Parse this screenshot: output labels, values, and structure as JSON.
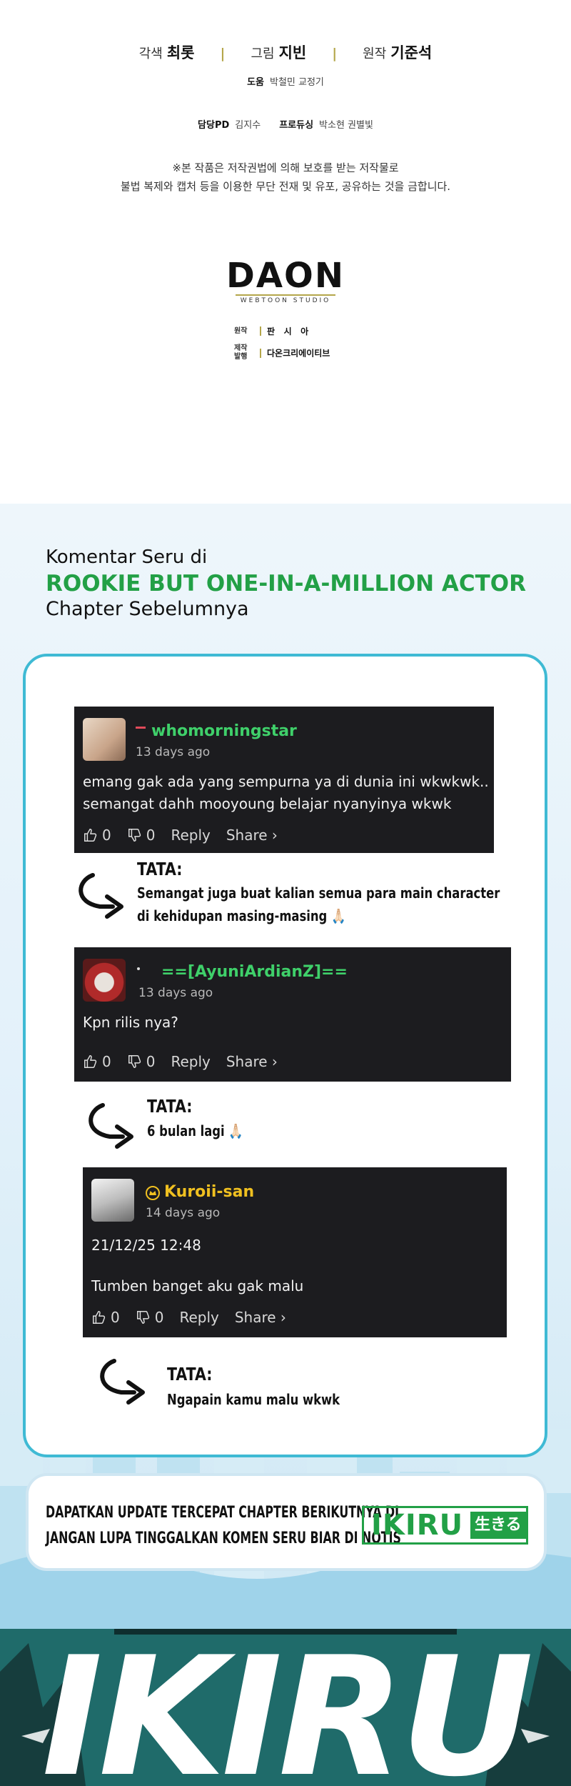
{
  "credits": {
    "roles": [
      {
        "label": "각색",
        "name": "최롯"
      },
      {
        "label": "그림",
        "name": "지빈"
      },
      {
        "label": "원작",
        "name": "기준석"
      }
    ],
    "assist": {
      "label": "도움",
      "names": "박철민 교정기"
    },
    "pd": {
      "label": "담당PD",
      "name": "김지수"
    },
    "producing": {
      "label": "프로듀싱",
      "names": "박소현 권별빛"
    },
    "notice_line1": "※본 작품은 저작권법에 의해 보호를 받는 저작물로",
    "notice_line2": "불법 복제와 캡처 등을 이용한 무단 전재 및 유포, 공유하는 것을 금합니다.",
    "studio_logo": "DAON",
    "studio_sub": "WEBTOON STUDIO",
    "original_label": "원작",
    "original_value": "판   시   아",
    "publisher_label_1": "제작",
    "publisher_label_2": "발행",
    "publisher_value": "다온크리에이티브"
  },
  "heading": {
    "line1": "Komentar Seru di",
    "line2": "ROOKIE BUT ONE-IN-A-MILLION ACTOR",
    "line3": "Chapter Sebelumnya"
  },
  "comments": [
    {
      "username": "whomorningstar",
      "time": "13 days ago",
      "body_line1": "emang gak ada yang sempurna ya di dunia ini wkwkwk..",
      "body_line2": "semangat dahh mooyoung belajar nyanyinya wkwk",
      "likes": "0",
      "dislikes": "0",
      "reply": "Reply",
      "share": "Share ›",
      "name_color": "#3fd06a",
      "reply_author": "TATA:",
      "reply_line1": "Semangat juga buat kalian semua para main character",
      "reply_line2": "di kehidupan masing-masing 🙏🏻"
    },
    {
      "username": "==[AyuniArdianZ]==",
      "time": "13 days ago",
      "body_line1": "Kpn rilis nya?",
      "likes": "0",
      "dislikes": "0",
      "reply": "Reply",
      "share": "Share ›",
      "name_color": "#3fd06a",
      "reply_author": "TATA:",
      "reply_line1": "6 bulan lagi 🙏🏻"
    },
    {
      "username": "Kuroii-san",
      "time": "14 days ago",
      "body_line1": "21/12/25 12:48",
      "body_line2": "Tumben banget aku gak malu",
      "likes": "0",
      "dislikes": "0",
      "reply": "Reply",
      "share": "Share ›",
      "name_color": "#f0c020",
      "reply_author": "TATA:",
      "reply_line1": "Ngapain kamu malu wkwk"
    }
  ],
  "banner": {
    "line1": "DAPATKAN UPDATE TERCEPAT CHAPTER BERIKUTNYA DI",
    "line2": "JANGAN LUPA TINGGALKAN KOMEN SERU BIAR DI NOTIS",
    "logo": "IKIRU",
    "logo_jp": "生きる"
  },
  "bottom_logo": "IKIRU",
  "colors": {
    "accent_green": "#22a046",
    "card_border": "#3fbad4",
    "comment_bg": "#1c1c1f"
  }
}
